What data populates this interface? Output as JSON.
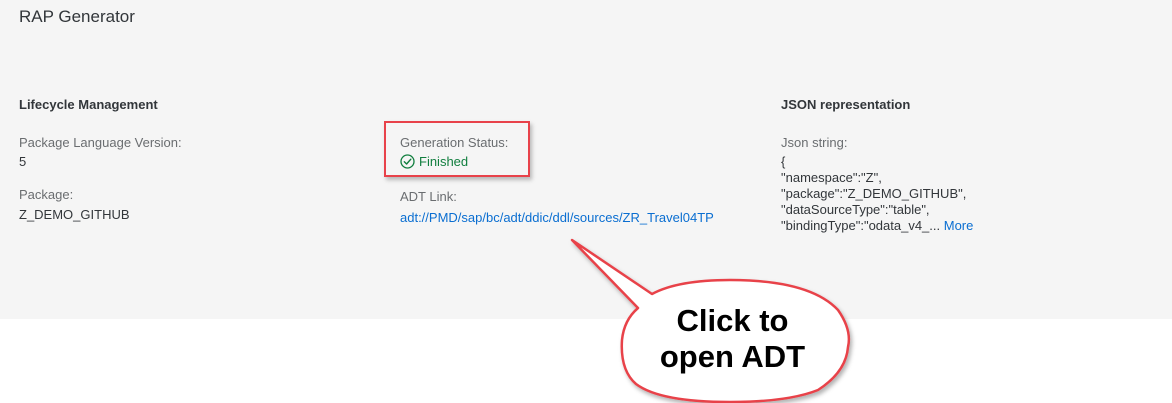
{
  "app": {
    "title": "RAP Generator"
  },
  "lifecycle": {
    "heading": "Lifecycle Management",
    "package_language_version_label": "Package Language Version:",
    "package_language_version_value": "5",
    "package_label": "Package:",
    "package_value": "Z_DEMO_GITHUB"
  },
  "generation": {
    "status_label": "Generation Status:",
    "status_value": "Finished",
    "status_icon": "check-circle-icon",
    "status_color": "#107e3e",
    "adt_link_label": "ADT Link:",
    "adt_link_value": "adt://PMD/sap/bc/adt/ddic/ddl/sources/ZR_Travel04TP"
  },
  "json_representation": {
    "heading": "JSON representation",
    "json_string_label": "Json string:",
    "lines": [
      "{",
      "\"namespace\":\"Z\",",
      "\"package\":\"Z_DEMO_GITHUB\",",
      "\"dataSourceType\":\"table\","
    ],
    "last_line": "\"bindingType\":\"odata_v4_...",
    "more_label": "More"
  },
  "annotation": {
    "callout_line1": "Click to",
    "callout_line2": "open ADT",
    "highlight_color": "#e8424a"
  }
}
